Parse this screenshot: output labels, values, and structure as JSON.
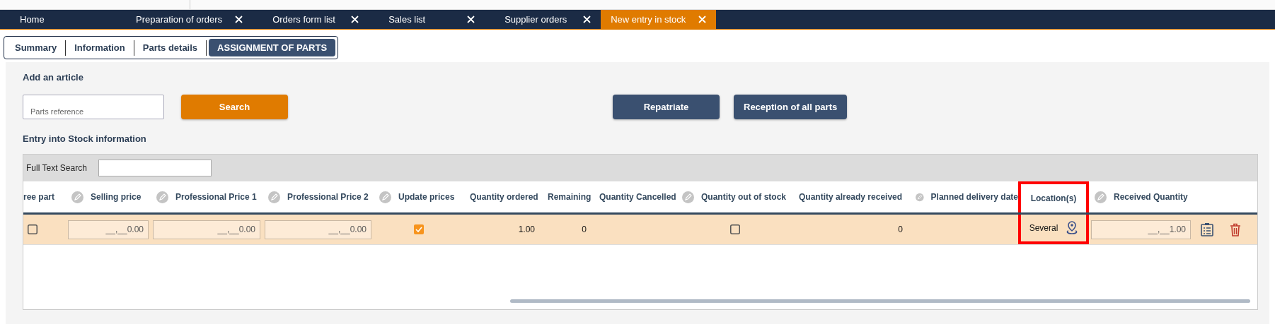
{
  "tabs": [
    {
      "label": "Home",
      "closable": false,
      "selected": false
    },
    {
      "label": "Preparation of orders",
      "closable": true,
      "selected": false
    },
    {
      "label": "Orders form list",
      "closable": true,
      "selected": false
    },
    {
      "label": "Sales list",
      "closable": true,
      "selected": false
    },
    {
      "label": "Supplier orders",
      "closable": true,
      "selected": false
    },
    {
      "label": "New entry in stock",
      "closable": true,
      "selected": true
    }
  ],
  "sections": [
    {
      "label": "Summary",
      "selected": false
    },
    {
      "label": "Information",
      "selected": false
    },
    {
      "label": "Parts details",
      "selected": false
    },
    {
      "label": "ASSIGNMENT OF PARTS",
      "selected": true
    }
  ],
  "add_article": {
    "title": "Add an article",
    "reference": {
      "placeholder": "Parts reference"
    },
    "search_button": "Search",
    "buttons": [
      "Repatriate",
      "Reception of all parts"
    ]
  },
  "stock_info": {
    "title": "Entry into Stock information",
    "full_text_search": {
      "label": "Full Text Search"
    },
    "columns": [
      {
        "label": "ree part",
        "editable": false,
        "highlighted": false
      },
      {
        "label": "Selling price",
        "editable": true,
        "highlighted": false
      },
      {
        "label": "Professional Price 1",
        "editable": true,
        "highlighted": false
      },
      {
        "label": "Professional Price 2",
        "editable": true,
        "highlighted": false
      },
      {
        "label": "Update prices",
        "editable": true,
        "highlighted": false
      },
      {
        "label": "Quantity ordered",
        "editable": false,
        "highlighted": false
      },
      {
        "label": "Remaining",
        "editable": false,
        "highlighted": false
      },
      {
        "label": "Quantity Cancelled",
        "editable": false,
        "highlighted": false
      },
      {
        "label": "Quantity out of stock",
        "editable": true,
        "highlighted": false
      },
      {
        "label": "Quantity already received",
        "editable": false,
        "highlighted": false
      },
      {
        "label": "Planned delivery date",
        "editable": true,
        "highlighted": false
      },
      {
        "label": "Location(s)",
        "editable": false,
        "highlighted": true
      },
      {
        "label": "Received Quantity",
        "editable": true,
        "highlighted": false
      }
    ],
    "rows": [
      {
        "selected": true,
        "cells": [
          {
            "kind": "checkbox",
            "checked": false
          },
          {
            "kind": "input",
            "value": "__,__0.00"
          },
          {
            "kind": "input",
            "value": "__,__0.00"
          },
          {
            "kind": "input",
            "value": "__,__0.00"
          },
          {
            "kind": "checkbox",
            "checked": true
          },
          {
            "kind": "number",
            "text": "1.00"
          },
          {
            "kind": "number",
            "text": "0"
          },
          {
            "kind": "empty"
          },
          {
            "kind": "checkbox",
            "checked": false
          },
          {
            "kind": "number",
            "text": "0"
          },
          {
            "kind": "empty"
          },
          {
            "kind": "location",
            "text": "Several"
          },
          {
            "kind": "input",
            "value": "__,__1.00"
          }
        ]
      }
    ]
  }
}
